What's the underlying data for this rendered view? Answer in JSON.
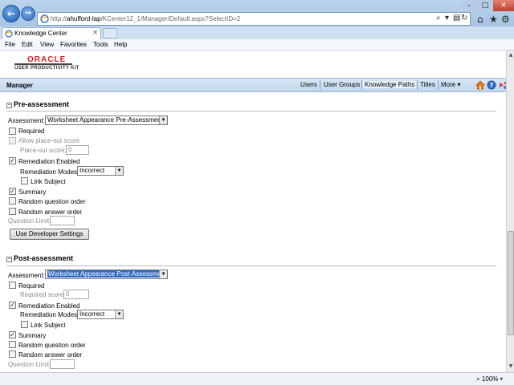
{
  "browser": {
    "url_prefix": "http://",
    "url_host": "ahufford-lap",
    "url_path": "/KCenter12_1/Manager/Default.aspx?SelectID=2",
    "tab_label": "Knowledge Center",
    "menu": [
      "File",
      "Edit",
      "View",
      "Favorites",
      "Tools",
      "Help"
    ],
    "zoom": "100%"
  },
  "branding": {
    "logo": "ORACLE",
    "subtitle": "USER PRODUCTIVITY KIT",
    "colors": {
      "oracle_red": "#e31b23",
      "header_bg": "#c2d6ec",
      "selection": "#316ac5"
    }
  },
  "header": {
    "title": "Manager",
    "nav": [
      "Users",
      "User Groups",
      "Knowledge Paths",
      "Titles",
      "More"
    ]
  },
  "pre": {
    "title": "Pre-assessment",
    "assessment_label": "Assessment:",
    "assessment_value": "Worksheet Appearance Pre-Assessment",
    "required": "Required",
    "allow_placeout": "Allow place-out score",
    "placeout_label": "Place-out score:",
    "placeout_value": "0",
    "remediation_enabled": "Remediation Enabled",
    "remediation_modes_label": "Remediation Modes:",
    "remediation_modes_value": "Incorrect",
    "link_subject": "Link Subject",
    "summary": "Summary",
    "random_question": "Random question order",
    "random_answer": "Random answer order",
    "question_limit": "Question Limit:",
    "dev_button": "Use Developer Settings"
  },
  "post": {
    "title": "Post-assessment",
    "assessment_label": "Assessment:",
    "assessment_value": "Worksheet Appearance Post-Assessment",
    "required": "Required",
    "required_score_label": "Required score:",
    "required_score_value": "0",
    "remediation_enabled": "Remediation Enabled",
    "remediation_modes_label": "Remediation Modes:",
    "remediation_modes_value": "Incorrect",
    "link_subject": "Link Subject",
    "summary": "Summary",
    "random_question": "Random question order",
    "random_answer": "Random answer order",
    "question_limit": "Question Limit:"
  }
}
